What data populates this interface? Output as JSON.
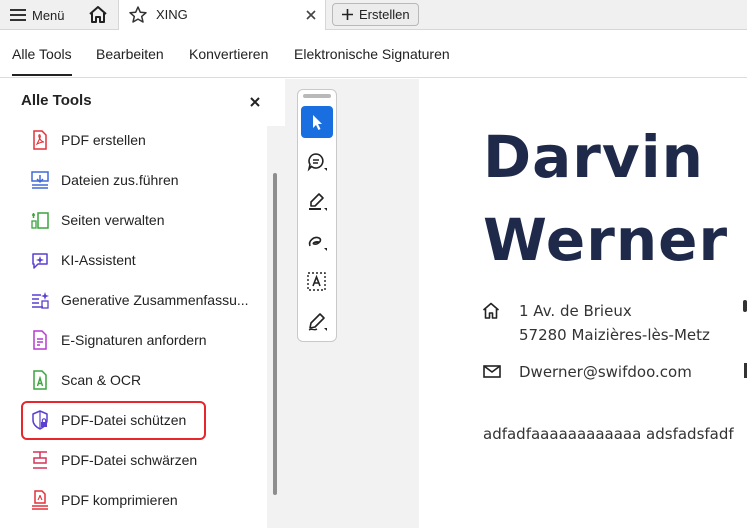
{
  "tabbar": {
    "menu_label": "Menü",
    "tab_title": "XING",
    "new_label": "Erstellen"
  },
  "toolrow": {
    "tabs": [
      {
        "label": "Alle Tools"
      },
      {
        "label": "Bearbeiten"
      },
      {
        "label": "Konvertieren"
      },
      {
        "label": "Elektronische Signaturen"
      }
    ]
  },
  "panel": {
    "title": "Alle Tools",
    "items": [
      {
        "label": "PDF erstellen",
        "icon": "pdf-create-icon",
        "color": "#e0323a"
      },
      {
        "label": "Dateien zus.führen",
        "icon": "combine-files-icon",
        "color": "#3f6ad8"
      },
      {
        "label": "Seiten verwalten",
        "icon": "organize-pages-icon",
        "color": "#3aa43f"
      },
      {
        "label": "KI-Assistent",
        "icon": "ai-assistant-icon",
        "color": "#5b3fd0"
      },
      {
        "label": "Generative Zusammenfassu...",
        "icon": "generative-summary-icon",
        "color": "#5b3fd0"
      },
      {
        "label": "E-Signaturen anfordern",
        "icon": "request-esign-icon",
        "color": "#b93ad0"
      },
      {
        "label": "Scan & OCR",
        "icon": "scan-ocr-icon",
        "color": "#3aa43f"
      },
      {
        "label": "PDF-Datei schützen",
        "icon": "protect-pdf-icon",
        "color": "#5b3fd0"
      },
      {
        "label": "PDF-Datei schwärzen",
        "icon": "redact-pdf-icon",
        "color": "#d6345a"
      },
      {
        "label": "PDF komprimieren",
        "icon": "compress-pdf-icon",
        "color": "#e0323a"
      }
    ]
  },
  "toolbox": {
    "tools": [
      "select-cursor-icon",
      "add-comment-icon",
      "highlight-pen-icon",
      "draw-freeform-icon",
      "text-recognition-icon",
      "fill-sign-icon"
    ]
  },
  "document": {
    "first_name": "Darvin",
    "last_name": "Werner",
    "address_line1": "1 Av. de Brieux",
    "address_line2": "57280 Maizières-lès-Metz",
    "email": "Dwerner@swifdoo.com",
    "body_text": "adfadfaaaaaaaaaaaa adsfadsfadf"
  },
  "colors": {
    "accent": "#1a6fe0",
    "highlight_border": "#e8262b",
    "name_color": "#1f2a4a"
  }
}
